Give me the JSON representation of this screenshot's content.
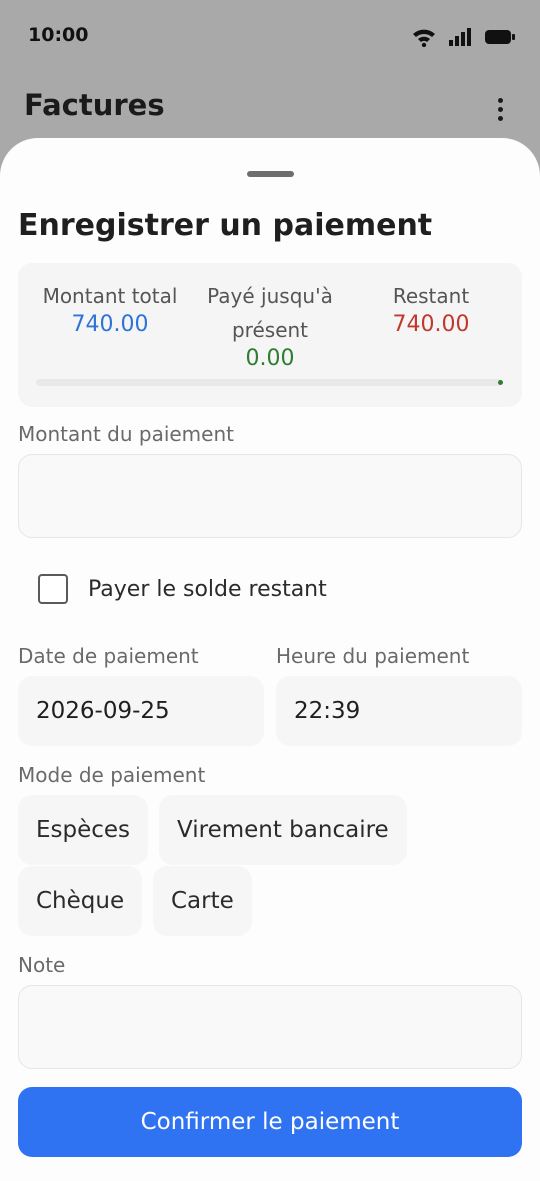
{
  "status_bar": {
    "time": "10:00"
  },
  "app_bar": {
    "title": "Factures"
  },
  "sheet": {
    "title": "Enregistrer un paiement",
    "summary": {
      "total_label": "Montant total",
      "total_value": "740.00",
      "paid_label_line1": "Payé jusqu'à",
      "paid_label_line2": "présent",
      "paid_value": "0.00",
      "remaining_label": "Restant",
      "remaining_value": "740.00",
      "progress_fraction": 0.0
    },
    "amount": {
      "label": "Montant du paiement",
      "value": "",
      "placeholder": ""
    },
    "pay_remaining": {
      "label": "Payer le solde restant",
      "checked": false
    },
    "date": {
      "label": "Date de paiement",
      "value": "2026-09-25"
    },
    "time": {
      "label": "Heure du paiement",
      "value": "22:39"
    },
    "method": {
      "label": "Mode de paiement",
      "options": [
        "Espèces",
        "Virement bancaire",
        "Chèque",
        "Carte"
      ]
    },
    "note": {
      "label": "Note",
      "value": "",
      "placeholder": ""
    },
    "confirm_label": "Confirmer le paiement"
  },
  "colors": {
    "total": "#2f73d8",
    "paid": "#2e7d32",
    "remaining": "#c0392b",
    "primary": "#2f73f2"
  }
}
